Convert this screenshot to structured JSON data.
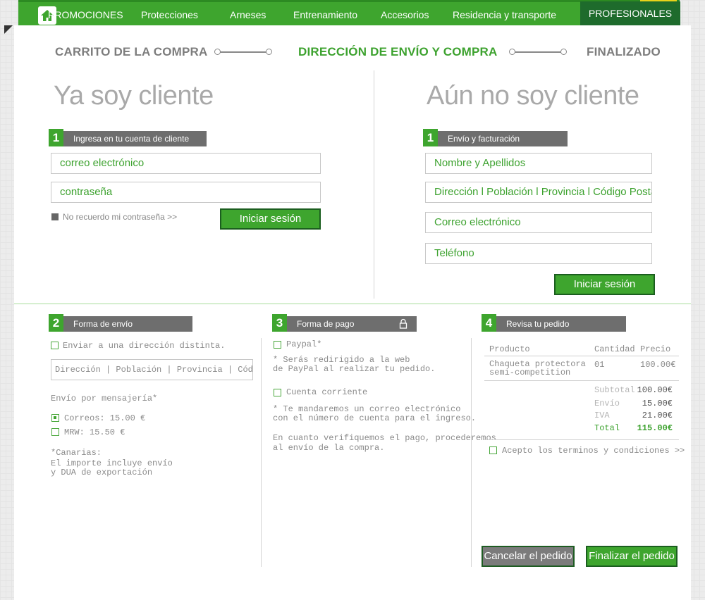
{
  "nav": {
    "items": [
      "PROMOCIONES",
      "Protecciones",
      "Arneses",
      "Entrenamiento",
      "Accesorios",
      "Residencia y transporte"
    ],
    "pro_label": "PROFESIONALES",
    "home_icon": "home-icon"
  },
  "steps": {
    "cart": "CARRITO DE LA COMPRA",
    "shipping": "DIRECCIÓN DE ENVÍO Y COMPRA",
    "done": "FINALIZADO"
  },
  "left": {
    "title": "Ya soy cliente",
    "section_num": "1",
    "section_label": "Ingresa en tu cuenta de cliente",
    "email_placeholder": "correo electrónico",
    "password_placeholder": "contraseña",
    "forgot": "No recuerdo mi contraseña >>",
    "login_btn": "Iniciar sesión"
  },
  "right": {
    "title": "Aún no soy cliente",
    "section_num": "1",
    "section_label": "Envío y facturación",
    "name_placeholder": "Nombre y Apellidos",
    "address_placeholder": "Dirección l Población l Provincia l Código Postal",
    "email_placeholder": "Correo electrónico",
    "phone_placeholder": "Teléfono",
    "login_btn": "Iniciar sesión"
  },
  "shipping": {
    "num": "2",
    "label": "Forma de envío",
    "alt_address": "Enviar a una dirección distinta.",
    "address_placeholder": "Dirección | Población | Provincia | Código Postal",
    "courier_label": "Envío por mensajería*",
    "options": [
      {
        "label": "Correos: 15.00 €",
        "checked": true
      },
      {
        "label": "MRW: 15.50 €",
        "checked": false
      }
    ],
    "note_lines": [
      "*Canarias:",
      "El importe incluye envío",
      "y DUA de exportación"
    ]
  },
  "payment": {
    "num": "3",
    "label": "Forma de pago",
    "lock_icon": "lock-icon",
    "paypal": "Paypal*",
    "paypal_note": [
      "* Serás redirigido a la web",
      "de PayPal al realizar tu pedido."
    ],
    "account": "Cuenta corriente",
    "account_note": [
      "* Te mandaremos un correo electrónico",
      "con el número de cuenta para el ingreso."
    ],
    "verify_note": [
      "En cuanto verifiquemos el pago, procederemos",
      "al envío de la compra."
    ]
  },
  "review": {
    "num": "4",
    "label": "Revisa tu pedido",
    "headers": {
      "product": "Producto",
      "qty": "Cantidad",
      "price": "Precio"
    },
    "items": [
      {
        "name_lines": [
          "Chaqueta protectora",
          "semi-competition"
        ],
        "qty": "01",
        "price": "100.00€"
      }
    ],
    "totals": [
      {
        "label": "Subtotal",
        "value": "100.00€"
      },
      {
        "label": "Envío",
        "value": "15.00€"
      },
      {
        "label": "IVA",
        "value": "21.00€"
      },
      {
        "label": "Total",
        "value": "115.00€"
      }
    ],
    "terms": "Acepto los terminos y condiciones >>",
    "cancel_btn": "Cancelar el pedido",
    "finish_btn": "Finalizar el pedido"
  },
  "colors": {
    "accent": "#3ea52e",
    "dark_green": "#1e6b2c",
    "gray_bar": "#6e6e6e"
  }
}
